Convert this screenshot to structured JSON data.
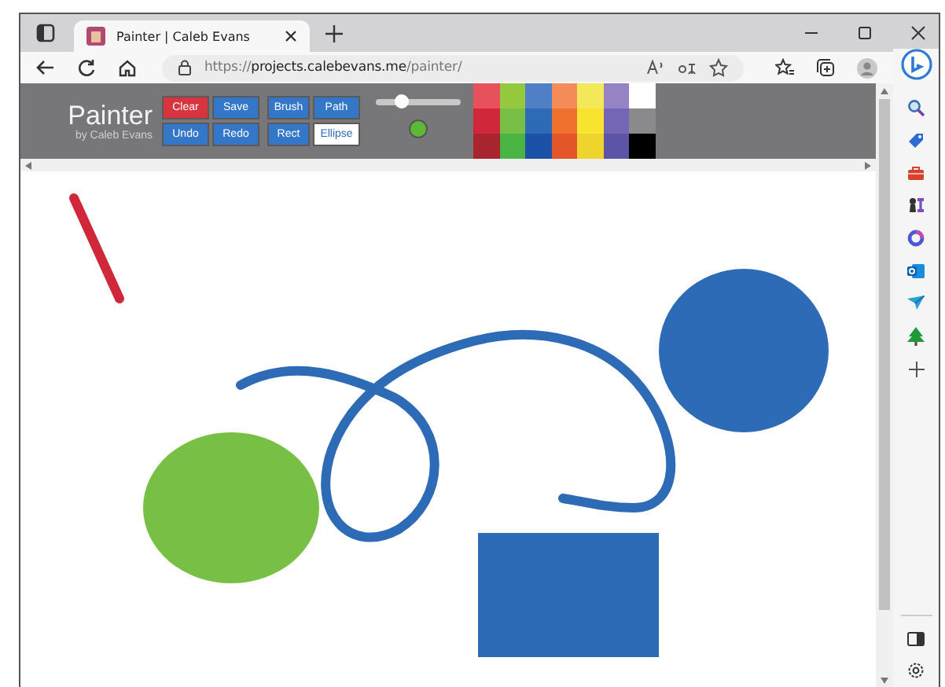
{
  "tab": {
    "title": "Painter | Caleb Evans"
  },
  "address": {
    "scheme": "https://",
    "host": "projects.calebevans.me",
    "path": "/painter/"
  },
  "painter": {
    "title": "Painter",
    "byline": "by Caleb Evans",
    "buttons": [
      {
        "label": "Clear",
        "kind": "danger",
        "selected": false
      },
      {
        "label": "Save",
        "kind": "action",
        "selected": false
      },
      {
        "label": "Brush",
        "kind": "tool",
        "selected": false
      },
      {
        "label": "Path",
        "kind": "tool",
        "selected": false
      },
      {
        "label": "Undo",
        "kind": "action",
        "selected": false
      },
      {
        "label": "Redo",
        "kind": "action",
        "selected": false
      },
      {
        "label": "Rect",
        "kind": "tool",
        "selected": false
      },
      {
        "label": "Ellipse",
        "kind": "tool",
        "selected": true
      }
    ],
    "brush_size": {
      "level": 0.3
    },
    "current_color": {
      "color": "#5cb836"
    },
    "palette": [
      {
        "color": "#e8505b"
      },
      {
        "color": "#94c83d"
      },
      {
        "color": "#4f80c6"
      },
      {
        "color": "#f48c5a"
      },
      {
        "color": "#f2e85a"
      },
      {
        "color": "#9683c4"
      },
      {
        "color": "#ffffff"
      },
      {
        "color": "#d0283a"
      },
      {
        "color": "#78bf45"
      },
      {
        "color": "#2d6bb7"
      },
      {
        "color": "#f0702e"
      },
      {
        "color": "#f9e530"
      },
      {
        "color": "#7466b4"
      },
      {
        "color": "#8a8a8c"
      },
      {
        "color": "#a8242e"
      },
      {
        "color": "#4bb544"
      },
      {
        "color": "#1b52a7"
      },
      {
        "color": "#e2562a"
      },
      {
        "color": "#efd42e"
      },
      {
        "color": "#5c54a6"
      },
      {
        "color": "#000000"
      }
    ]
  },
  "canvas": {
    "shapes": [
      {
        "kind": "line",
        "color": "#d0283a"
      },
      {
        "kind": "ellipse",
        "color": "#78bf45"
      },
      {
        "kind": "circle",
        "color": "#2d6bb7"
      },
      {
        "kind": "rect",
        "color": "#2d6bb7"
      },
      {
        "kind": "path",
        "color": "#2d6bb7"
      }
    ]
  }
}
